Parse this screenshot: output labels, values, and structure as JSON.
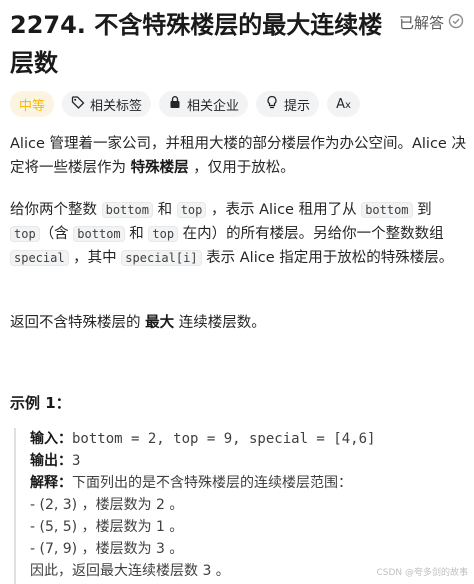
{
  "header": {
    "title": "2274. 不含特殊楼层的最大连续楼层数",
    "solved_label": "已解答"
  },
  "tags": {
    "difficulty": "中等",
    "related_tags": "相关标签",
    "related_companies": "相关企业",
    "hint": "提示"
  },
  "description": {
    "p1_a": "Alice 管理着一家公司，并租用大楼的部分楼层作为办公空间。Alice 决定将一些楼层作为 ",
    "p1_bold": "特殊楼层",
    "p1_b": " ，仅用于放松。",
    "p2_a": "给你两个整数 ",
    "p2_code1": "bottom",
    "p2_b": " 和 ",
    "p2_code2": "top",
    "p2_c": " ，表示 Alice 租用了从 ",
    "p2_code3": "bottom",
    "p2_d": " 到 ",
    "p2_code4": "top",
    "p2_e": "（含 ",
    "p2_code5": "bottom",
    "p2_f": " 和 ",
    "p2_code6": "top",
    "p2_g": " 在内）的所有楼层。另给你一个整数数组 ",
    "p2_code7": "special",
    "p2_h": " ，其中 ",
    "p2_code8": "special[i]",
    "p2_i": " 表示  Alice 指定用于放松的特殊楼层。",
    "p3_a": "返回不含特殊楼层的 ",
    "p3_bold": "最大",
    "p3_b": " 连续楼层数。"
  },
  "example": {
    "title": "示例 1：",
    "input_label": "输入：",
    "input_value": "bottom = 2, top = 9, special = [4,6]",
    "output_label": "输出：",
    "output_value": "3",
    "explain_label": "解释：",
    "explain_value": "下面列出的是不含特殊楼层的连续楼层范围：",
    "line1": "- (2, 3) ，楼层数为 2 。",
    "line2": "- (5, 5) ，楼层数为 1 。",
    "line3": "- (7, 9) ，楼层数为 3 。",
    "conclusion": "因此，返回最大连续楼层数 3 。"
  },
  "watermark": "CSDN @夸多剑的故事"
}
